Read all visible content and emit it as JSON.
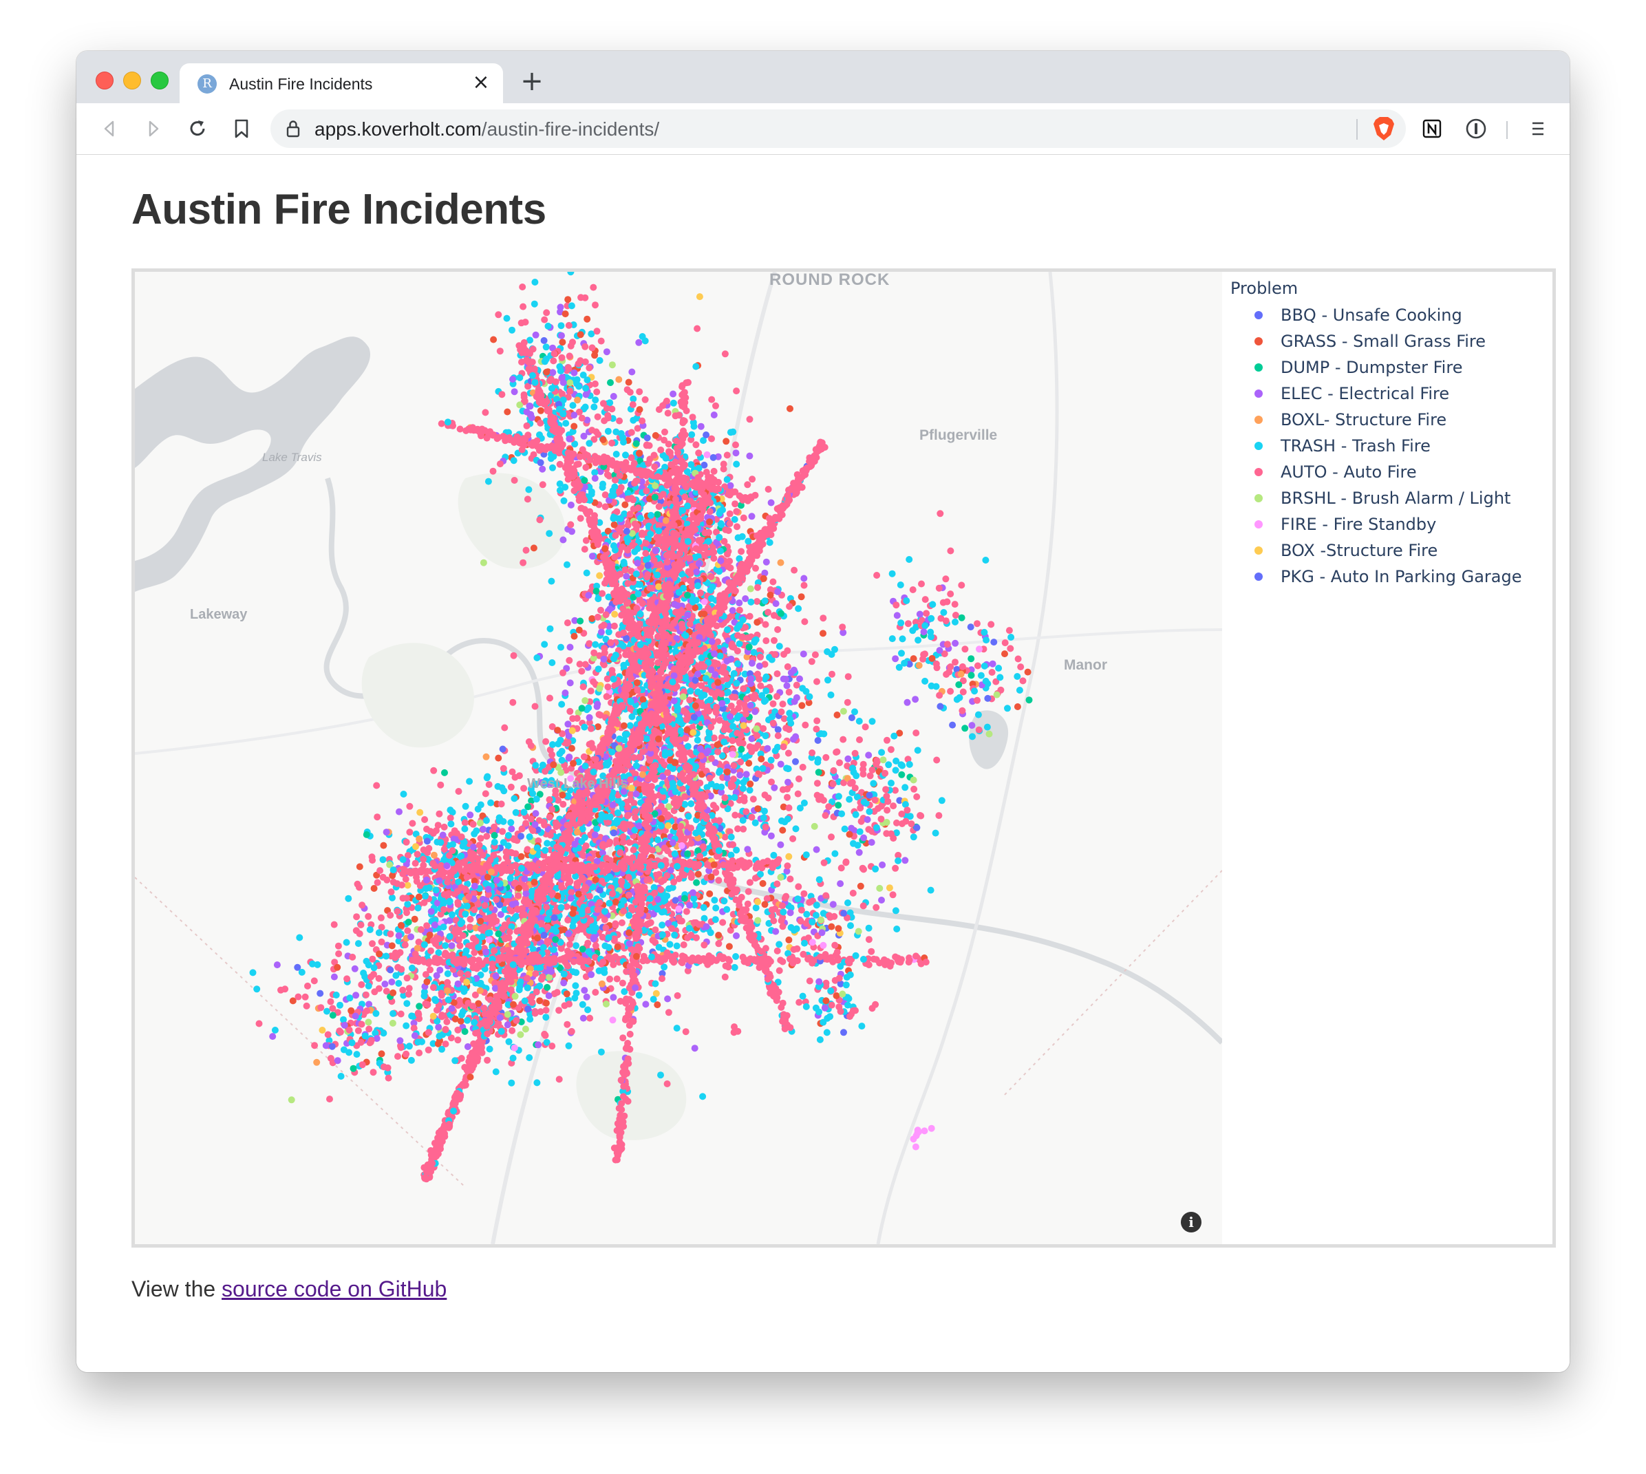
{
  "browser": {
    "tab_title": "Austin Fire Incidents",
    "tab_favicon_letter": "R",
    "tab_close": "×",
    "new_tab": "+",
    "url_host": "apps.koverholt.com",
    "url_path": "/austin-fire-incidents/"
  },
  "page": {
    "title": "Austin Fire Incidents",
    "footer_prefix": "View the ",
    "footer_link": "source code on GitHub"
  },
  "map": {
    "labels": {
      "round_rock": "ROUND ROCK",
      "pflugerville": "Pflugerville",
      "lake_travis": "Lake Travis",
      "lakeway": "Lakeway",
      "manor": "Manor",
      "west_lake_hills": "West Lake Hills"
    },
    "info_glyph": "i"
  },
  "chart_data": {
    "type": "scatter",
    "subtype": "scatter_mapbox",
    "region": "Austin, Texas",
    "legend_title": "Problem",
    "legend_position": "top-right",
    "grid": false,
    "series": [
      {
        "name": "BBQ - Unsafe Cooking",
        "color": "#636efa",
        "share": 0.02
      },
      {
        "name": "GRASS - Small Grass Fire",
        "color": "#ef553b",
        "share": 0.07
      },
      {
        "name": "DUMP - Dumpster Fire",
        "color": "#00cc96",
        "share": 0.02
      },
      {
        "name": "ELEC - Electrical Fire",
        "color": "#ab63fa",
        "share": 0.12
      },
      {
        "name": "BOXL- Structure Fire",
        "color": "#ffa15a",
        "share": 0.015
      },
      {
        "name": "TRASH - Trash Fire",
        "color": "#19d3f3",
        "share": 0.3
      },
      {
        "name": "AUTO - Auto Fire",
        "color": "#ff6692",
        "share": 0.42
      },
      {
        "name": "BRSHL - Brush Alarm / Light",
        "color": "#b6e880",
        "share": 0.02
      },
      {
        "name": "FIRE - Fire Standby",
        "color": "#ff97ff",
        "share": 0.005
      },
      {
        "name": "BOX -Structure Fire",
        "color": "#fecb52",
        "share": 0.01
      },
      {
        "name": "PKG - Auto In Parking Garage",
        "color": "#636efa",
        "share": 0.005
      }
    ]
  }
}
